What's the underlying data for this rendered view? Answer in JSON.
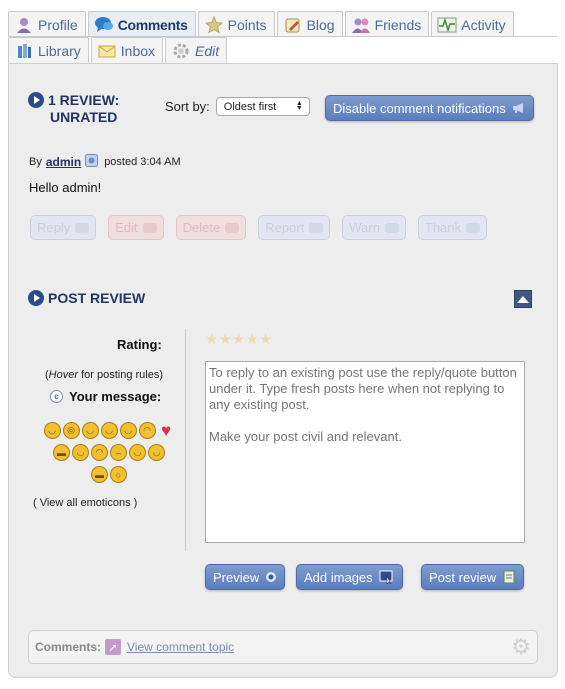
{
  "tabs_row1": [
    {
      "label": "Profile",
      "icon": "profile-icon",
      "active": false
    },
    {
      "label": "Comments",
      "icon": "comments-icon",
      "active": true
    },
    {
      "label": "Points",
      "icon": "star-icon",
      "active": false
    },
    {
      "label": "Blog",
      "icon": "blog-icon",
      "active": false
    },
    {
      "label": "Friends",
      "icon": "friends-icon",
      "active": false
    },
    {
      "label": "Activity",
      "icon": "activity-icon",
      "active": false
    }
  ],
  "tabs_row2": [
    {
      "label": "Library",
      "icon": "library-icon"
    },
    {
      "label": "Inbox",
      "icon": "inbox-icon"
    },
    {
      "label": "Edit",
      "icon": "gear-icon"
    }
  ],
  "review": {
    "title_line1": "1 REVIEW:",
    "title_line2": "UNRATED",
    "sort_label": "Sort by:",
    "sort_value": "Oldest first",
    "disable_notifications": "Disable comment notifications"
  },
  "post": {
    "by": "By",
    "author": "admin",
    "posted": "posted 3:04 AM",
    "body": "Hello admin!",
    "actions": [
      "Reply",
      "Edit",
      "Delete",
      "Report",
      "Warn",
      "Thank"
    ]
  },
  "post_review": {
    "title": "POST REVIEW",
    "rating_label": "Rating:",
    "hover_word": "Hover",
    "hover_rest": " for posting rules)",
    "hover_open": "(",
    "your_message": "Your message:",
    "view_all_emoticons": "( View all emoticons )",
    "placeholder": "To reply to an existing post use the reply/quote button under it. Type fresh posts here when not replying to any existing post.\n\nMake your post civil and relevant.",
    "buttons": {
      "preview": "Preview",
      "add_images": "Add images",
      "post_review": "Post review"
    }
  },
  "comments_bar": {
    "label": "Comments:",
    "link": "View comment topic"
  },
  "colors": {
    "accent": "#5b7dbd",
    "title": "#1f3564",
    "heart": "#d9304f"
  }
}
